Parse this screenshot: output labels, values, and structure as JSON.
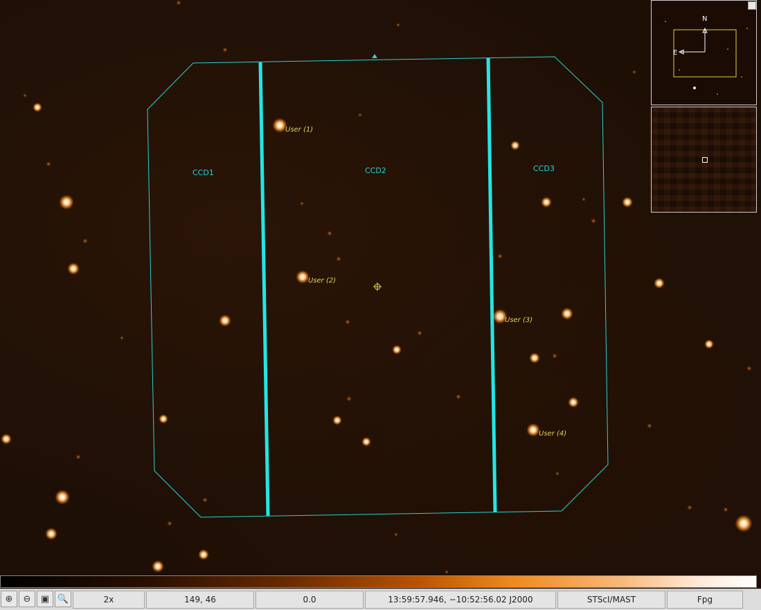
{
  "image": {
    "ccd_labels": [
      "CCD1",
      "CCD2",
      "CCD3"
    ],
    "user_markers": [
      "User (1)",
      "User (2)",
      "User (3)",
      "User (4)"
    ],
    "colors": {
      "footprint": "#2ad3d3",
      "marker": "#e6d25a",
      "background": "#1e0f05"
    }
  },
  "panner": {
    "north_label": "N",
    "east_label": "E"
  },
  "toolbar": {
    "zoom_in_icon": "zoom-in-icon",
    "zoom_out_icon": "zoom-out-icon",
    "zoom_fit_icon": "zoom-fit-icon",
    "zoom_icon": "zoom-icon"
  },
  "status": {
    "zoom": "2x",
    "pixel_coords": "149, 46",
    "pixel_value": "0.0",
    "world_coords": "13:59:57.946, −10:52:56.02 J2000",
    "source": "STScI/MAST",
    "band": "Fpg"
  }
}
